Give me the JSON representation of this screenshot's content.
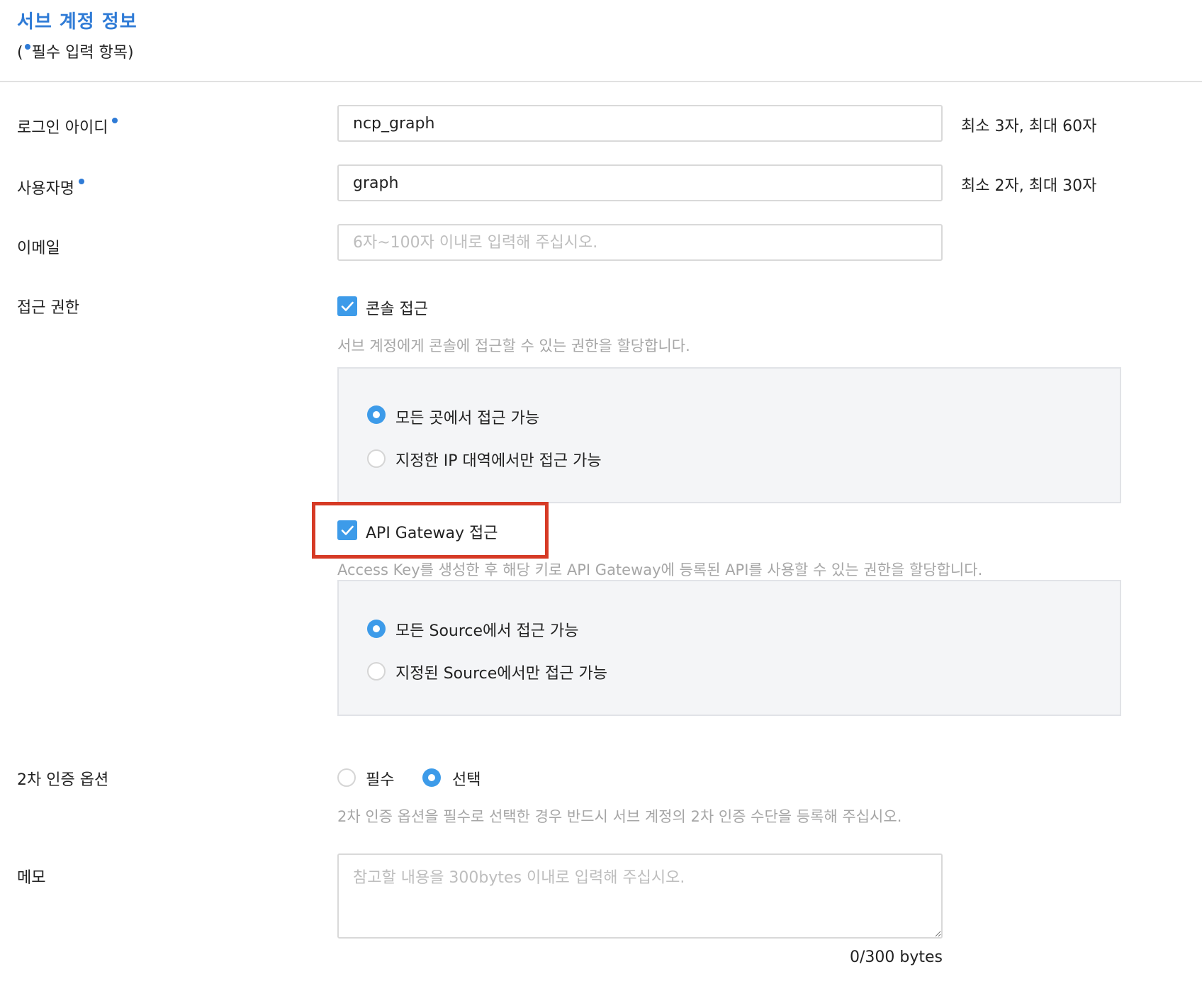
{
  "header": {
    "title": "서브 계정 정보",
    "required_note_open": "(",
    "required_note_text": "필수 입력 항목)"
  },
  "form": {
    "login_id": {
      "label": "로그인 아이디",
      "value": "ncp_graph",
      "hint": "최소 3자, 최대 60자"
    },
    "username": {
      "label": "사용자명",
      "value": "graph",
      "hint": "최소 2자, 최대 30자"
    },
    "email": {
      "label": "이메일",
      "value": "",
      "placeholder": "6자~100자 이내로 입력해 주십시오."
    },
    "access": {
      "label": "접근 권한",
      "console": {
        "checkbox_label": "콘솔 접근",
        "checked": true,
        "description": "서브 계정에게 콘솔에 접근할 수 있는 권한을 할당합니다.",
        "options": [
          "모든 곳에서 접근 가능",
          "지정한 IP 대역에서만 접근 가능"
        ],
        "selected": 0
      },
      "api_gateway": {
        "checkbox_label": "API Gateway 접근",
        "checked": true,
        "description": "Access Key를 생성한 후 해당 키로 API Gateway에 등록된 API를 사용할 수 있는 권한을 할당합니다.",
        "options": [
          "모든 Source에서 접근 가능",
          "지정된 Source에서만 접근 가능"
        ],
        "selected": 0
      }
    },
    "two_factor": {
      "label": "2차 인증 옵션",
      "options": [
        "필수",
        "선택"
      ],
      "selected": 1,
      "description": "2차 인증 옵션을 필수로 선택한 경우 반드시 서브 계정의 2차 인증 수단을 등록해 주십시오."
    },
    "memo": {
      "label": "메모",
      "value": "",
      "placeholder": "참고할 내용을 300bytes 이내로 입력해 주십시오.",
      "counter": "0/300 bytes"
    }
  },
  "colors": {
    "accent": "#2f7bd6",
    "control": "#3d9be9",
    "highlight_box": "#d63a25"
  }
}
